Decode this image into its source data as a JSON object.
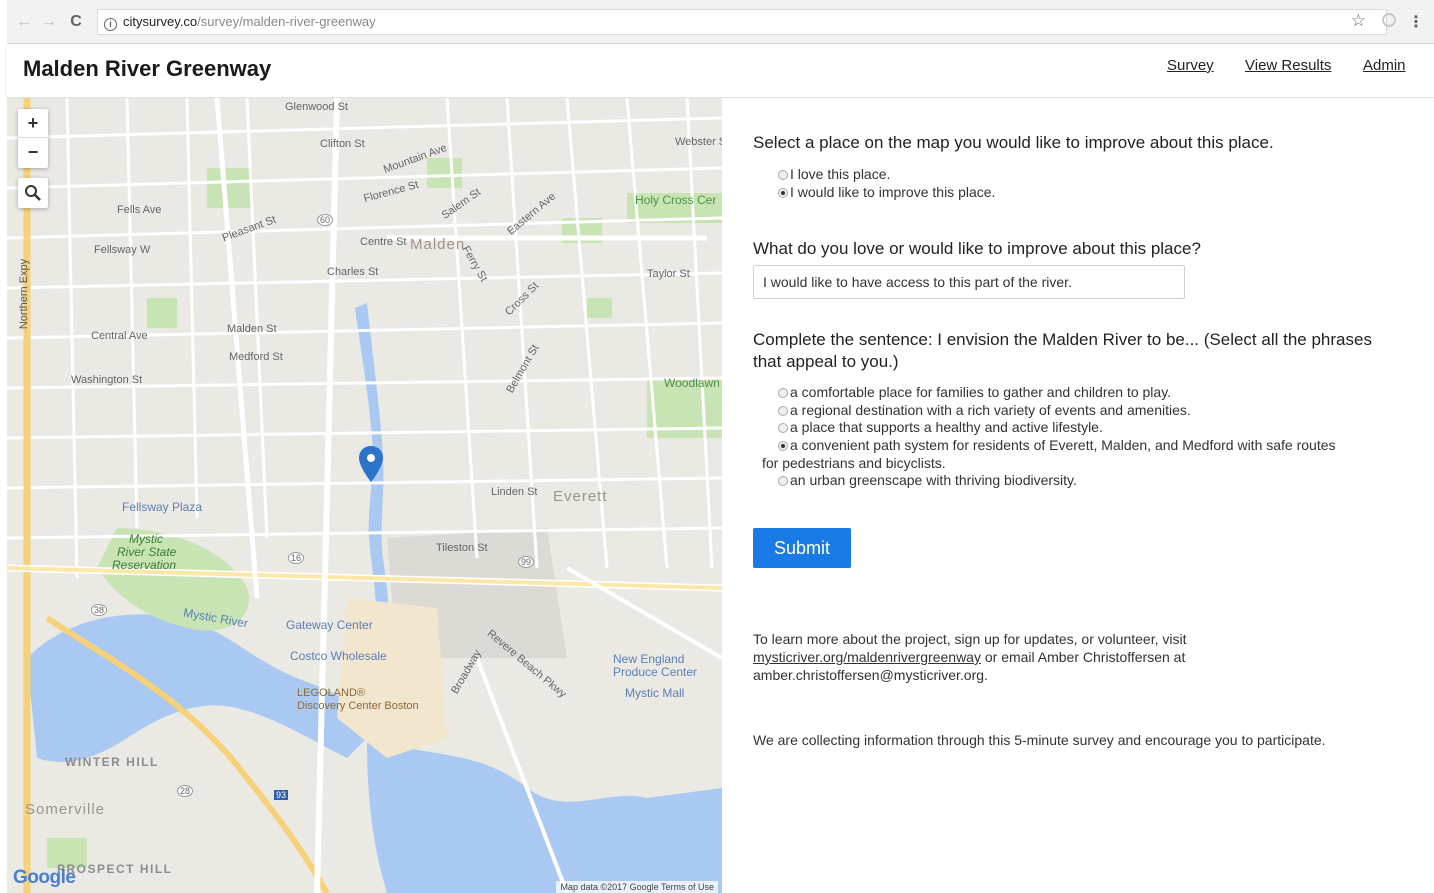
{
  "browser": {
    "url_host": "citysurvey.co",
    "url_path": "/survey/malden-river-greenway",
    "back_glyph": "←",
    "forward_glyph": "→",
    "reload_glyph": "C",
    "star_glyph": "☆",
    "menu_glyph": "⋮",
    "info_glyph": "i"
  },
  "header": {
    "title": "Malden River Greenway",
    "nav": {
      "survey": "Survey",
      "results": "View Results",
      "admin": "Admin"
    }
  },
  "map": {
    "zoom_in": "+",
    "zoom_out": "−",
    "google_logo": "Google",
    "attribution": "Map data ©2017 Google   Terms of Use",
    "labels": {
      "malden": "Malden",
      "everett": "Everett",
      "holy_cross": "Holy Cross Cer",
      "woodlawn": "Woodlawn",
      "fellsway_plaza": "Fellsway Plaza",
      "mystic_park_1": "Mystic",
      "mystic_park_2": "River State",
      "mystic_park_3": "Reservation",
      "mystic_river": "Mystic River",
      "gateway_center": "Gateway Center",
      "costco": "Costco Wholesale",
      "new_england_1": "New England",
      "new_england_2": "Produce Center",
      "mystic_mall": "Mystic Mall",
      "legoland_1": "LEGOLAND®",
      "legoland_2": "Discovery Center Boston",
      "winter_hill": "WINTER HILL",
      "somerville": "Somerville",
      "prospect_hill": "PROSPECT HILL",
      "centre_st": "Centre St",
      "charles_st": "Charles St",
      "medford_st": "Medford St",
      "malden_st": "Malden St",
      "pleasant_st": "Pleasant St",
      "florence_st": "Florence St",
      "mountain_ave": "Mountain Ave",
      "clifton_st": "Clifton St",
      "glenwood_st": "Glenwood St",
      "salem_st": "Salem St",
      "eastern_ave": "Eastern Ave",
      "taylor_st": "Taylor St",
      "central_ave": "Central Ave",
      "washington_st": "Washington St",
      "fellsway_w": "Fellsway W",
      "fells_ave": "Fells Ave",
      "linden_st": "Linden St",
      "tileston_st": "Tileston St",
      "northern_expy": "Northern Expy",
      "webster_st": "Webster St",
      "ferry_st": "Ferry St",
      "cross_st": "Cross St",
      "belmont_st": "Belmont St",
      "broadway": "Broadway",
      "revere_beach": "Revere Beach Pkwy",
      "route_60": "60",
      "route_16": "16",
      "route_99": "99",
      "route_28": "28",
      "route_38": "38",
      "route_93": "93"
    }
  },
  "form": {
    "q1": "Select a place on the map you would like to improve about this place.",
    "q1_options": [
      "I love this place.",
      "I would like to improve this place."
    ],
    "q1_selected": 1,
    "q2": "What do you love or would like to improve about this place?",
    "q2_value": "I would like to have access to this part of the river.",
    "q3": "Complete the sentence: I envision the Malden River to be... (Select all the phrases that appeal to you.)",
    "q3_options": [
      "a comfortable place for families to gather and children to play.",
      "a regional destination with a rich variety of events and amenities.",
      "a place that supports a healthy and active lifestyle.",
      "a convenient path system for residents of Everett, Malden, and Medford with safe routes",
      "for pedestrians and bicyclists.",
      "an urban greenscape with thriving biodiversity."
    ],
    "q3_selected": 3,
    "submit": "Submit",
    "info_1": "To learn more about the project, sign up for updates, or volunteer, visit",
    "info_link": "mysticriver.org/maldenrivergreenway",
    "info_2": " or email Amber Christoffersen at",
    "info_3": "amber.christoffersen@mysticriver.org.",
    "info_4": "We are collecting information through this 5-minute survey and encourage you to participate."
  }
}
